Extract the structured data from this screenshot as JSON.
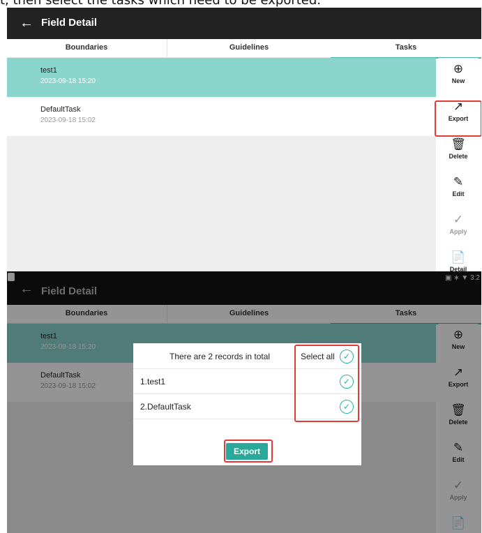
{
  "caption": "t, then select the tasks which need to be exported.",
  "app": {
    "back_icon": "←",
    "title": "Field Detail",
    "status": "▣ ∗ ▼ 3:2"
  },
  "tabs": [
    "Boundaries",
    "Guidelines",
    "Tasks"
  ],
  "tasks": [
    {
      "name": "test1",
      "date": "2023-09-18 15:20"
    },
    {
      "name": "DefaultTask",
      "date": "2023-09-18 15:02"
    }
  ],
  "side_buttons": [
    {
      "icon": "⊕",
      "label": "New"
    },
    {
      "icon": "↗",
      "label": "Export"
    },
    {
      "icon": "🗑",
      "label": "Delete"
    },
    {
      "icon": "✎",
      "label": "Edit"
    },
    {
      "icon": "✓",
      "label": "Apply"
    },
    {
      "icon": "📄",
      "label": "Detail"
    }
  ],
  "dialog": {
    "title": "There are 2 records in total",
    "select_all": "Select all",
    "check": "✓",
    "items": [
      "1.test1",
      "2.DefaultTask"
    ],
    "button": "Export"
  },
  "colors": {
    "accent": "#2aa89a",
    "selected_row": "#8ad5cc",
    "highlight": "#e53935"
  }
}
